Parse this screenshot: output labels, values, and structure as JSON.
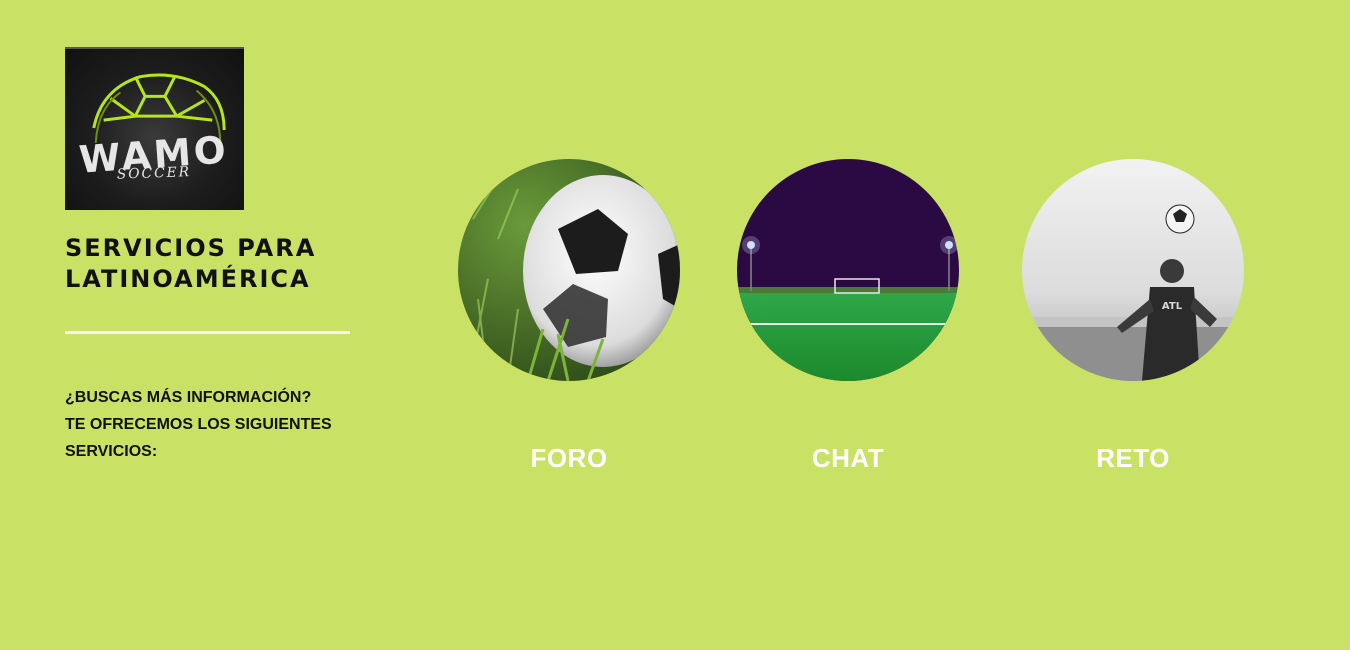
{
  "brand": {
    "logo_word": "WAMO",
    "logo_sub": "SOCCER",
    "logo_accent": "#b5e61d"
  },
  "header": {
    "line1": "SERVICIOS PARA",
    "line2": "LATINOAMÉRICA"
  },
  "intro": {
    "line1": "¿BUSCAS MÁS INFORMACIÓN?",
    "line2": "TE OFRECEMOS LOS SIGUIENTES",
    "line3": "SERVICIOS:"
  },
  "services": [
    {
      "label": "FORO",
      "image": "soccer-ball-on-grass"
    },
    {
      "label": "CHAT",
      "image": "stadium-field-night"
    },
    {
      "label": "RETO",
      "image": "player-heading-ball"
    }
  ],
  "colors": {
    "background": "#c9e265",
    "label_text": "#ffffff",
    "heading_text": "#111111"
  }
}
